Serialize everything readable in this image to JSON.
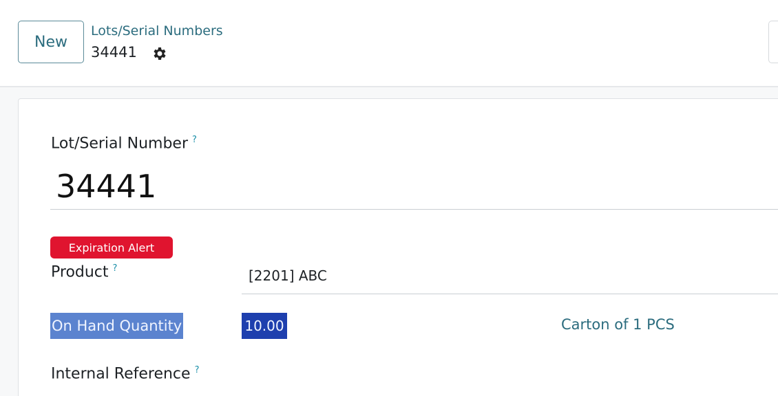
{
  "control_panel": {
    "new_button_label": "New",
    "breadcrumb": "Lots/Serial Numbers",
    "record_name": "34441"
  },
  "form": {
    "lot_label": "Lot/Serial Number",
    "help_mark": "?",
    "lot_value": "34441",
    "expiration_badge": "Expiration Alert",
    "product_label": "Product",
    "product_value": "[2201] ABC",
    "on_hand_label": "On Hand Quantity",
    "on_hand_value": "10.00",
    "uom_value": "Carton of 1 PCS",
    "internal_reference_label": "Internal Reference"
  },
  "colors": {
    "accent_link": "#2b6c7e",
    "badge_red": "#e0142f",
    "help_mark": "#1a8fa8",
    "selection_light": "#5b83cf",
    "selection_dark": "#1e3fae"
  },
  "icons": {
    "gear": "gear-icon"
  }
}
